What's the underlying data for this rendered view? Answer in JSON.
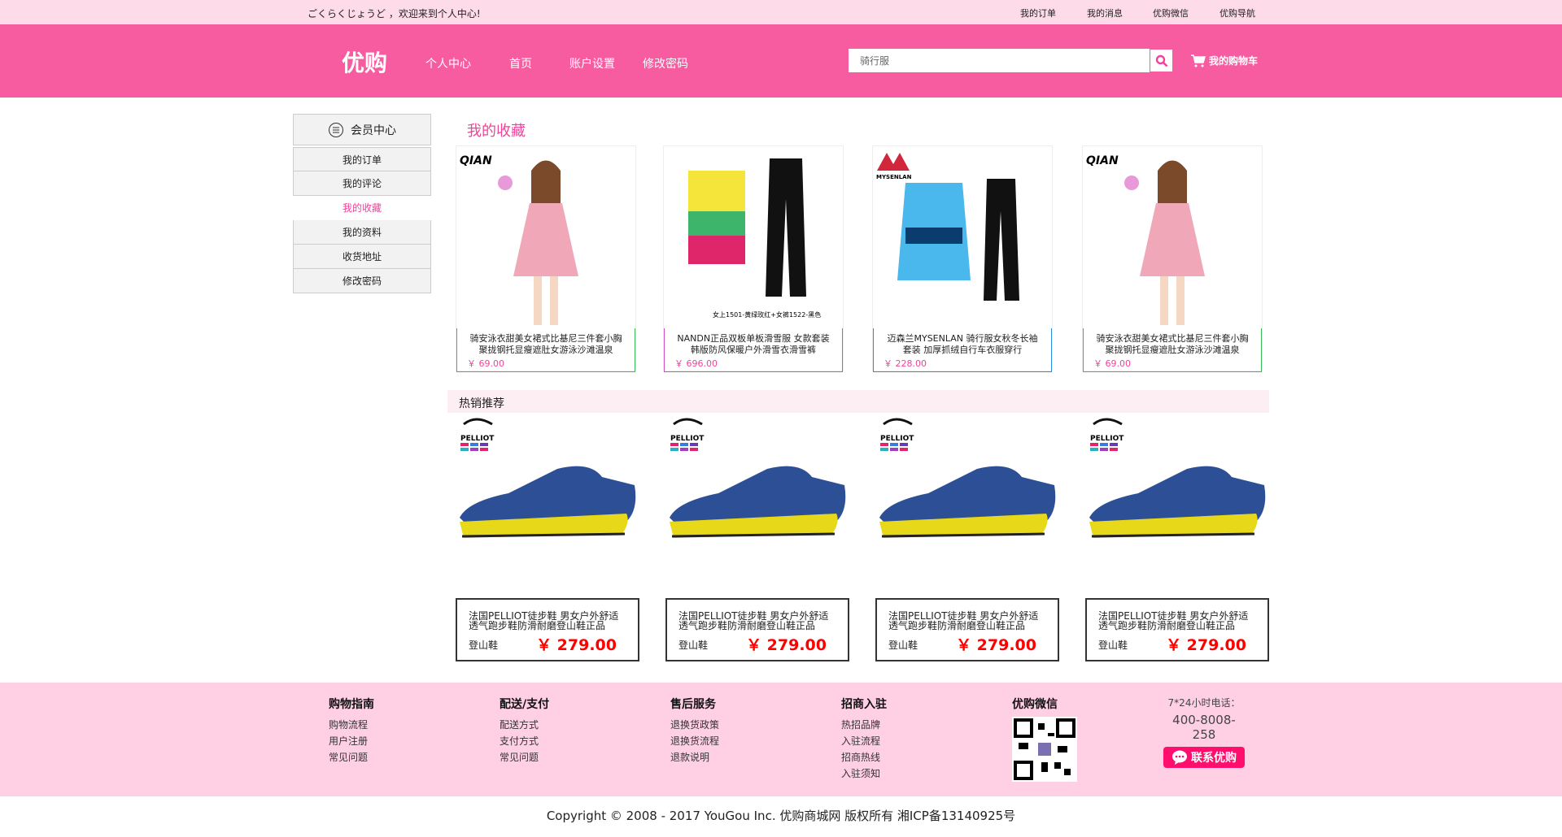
{
  "topbar": {
    "welcome": "ごくらくじょうど ，欢迎来到个人中心!",
    "links": [
      "我的订单",
      "我的消息",
      "优购微信",
      "优购导航"
    ]
  },
  "header": {
    "logo": "优购",
    "nav": [
      "个人中心",
      "首页",
      "账户设置",
      "修改密码"
    ],
    "search_value": "骑行服",
    "cart": "我的购物车"
  },
  "sidebar": {
    "title": "会员中心",
    "items": [
      "我的订单",
      "我的评论",
      "我的收藏",
      "我的资料",
      "收货地址",
      "修改密码"
    ],
    "active": "我的收藏"
  },
  "favorites": {
    "title": "我的收藏",
    "items": [
      {
        "name": "骑安泳衣甜美女裙式比基尼三件套小胸聚拢钢托显瘦遮肚女游泳沙滩温泉",
        "price": "￥ 69.00",
        "brand": "QIAN",
        "border": "#3cb95a"
      },
      {
        "name": "NANDN正品双板单板滑雪服 女款套装韩版防风保暖户外滑雪衣滑雪裤",
        "price": "￥ 696.00",
        "brand": "女上1501-黄绿玫红+女裤1522-黑色",
        "border": "#d050c8"
      },
      {
        "name": "迈森兰MYSENLAN 骑行服女秋冬长袖套装 加厚抓绒自行车衣服穿行",
        "price": "￥ 228.00",
        "brand": "MYSENLAN",
        "border": "#2a8ee0"
      },
      {
        "name": "骑安泳衣甜美女裙式比基尼三件套小胸聚拢钢托显瘦遮肚女游泳沙滩温泉",
        "price": "￥ 69.00",
        "brand": "QIAN",
        "border": "#3cb95a"
      }
    ]
  },
  "hot": {
    "title": "热销推荐",
    "items": [
      {
        "name": "法国PELLIOT徒步鞋 男女户外舒适透气跑步鞋防滑耐磨登山鞋正品",
        "category": "登山鞋",
        "price": "￥ 279.00",
        "brand": "PELLIOT"
      },
      {
        "name": "法国PELLIOT徒步鞋 男女户外舒适透气跑步鞋防滑耐磨登山鞋正品",
        "category": "登山鞋",
        "price": "￥ 279.00",
        "brand": "PELLIOT"
      },
      {
        "name": "法国PELLIOT徒步鞋 男女户外舒适透气跑步鞋防滑耐磨登山鞋正品",
        "category": "登山鞋",
        "price": "￥ 279.00",
        "brand": "PELLIOT"
      },
      {
        "name": "法国PELLIOT徒步鞋 男女户外舒适透气跑步鞋防滑耐磨登山鞋正品",
        "category": "登山鞋",
        "price": "￥ 279.00",
        "brand": "PELLIOT"
      }
    ]
  },
  "footer": {
    "cols": [
      {
        "title": "购物指南",
        "links": [
          "购物流程",
          "用户注册",
          "常见问题"
        ]
      },
      {
        "title": "配送/支付",
        "links": [
          "配送方式",
          "支付方式",
          "常见问题"
        ]
      },
      {
        "title": "售后服务",
        "links": [
          "退换货政策",
          "退换货流程",
          "退款说明"
        ]
      },
      {
        "title": "招商入驻",
        "links": [
          "热招品牌",
          "入驻流程",
          "招商热线",
          "入驻须知"
        ]
      }
    ],
    "wechat_title": "优购微信",
    "phone_label": "7*24小时电话：",
    "phone": "400-8008-258",
    "contact": "联系优购"
  },
  "copyright": "Copyright © 2008 - 2017 YouGou Inc. 优购商城网  版权所有    湘ICP备13140925号",
  "colors": {
    "brand": "#f75ca0",
    "accent": "#f0439a",
    "price_red": "#ff0000"
  }
}
